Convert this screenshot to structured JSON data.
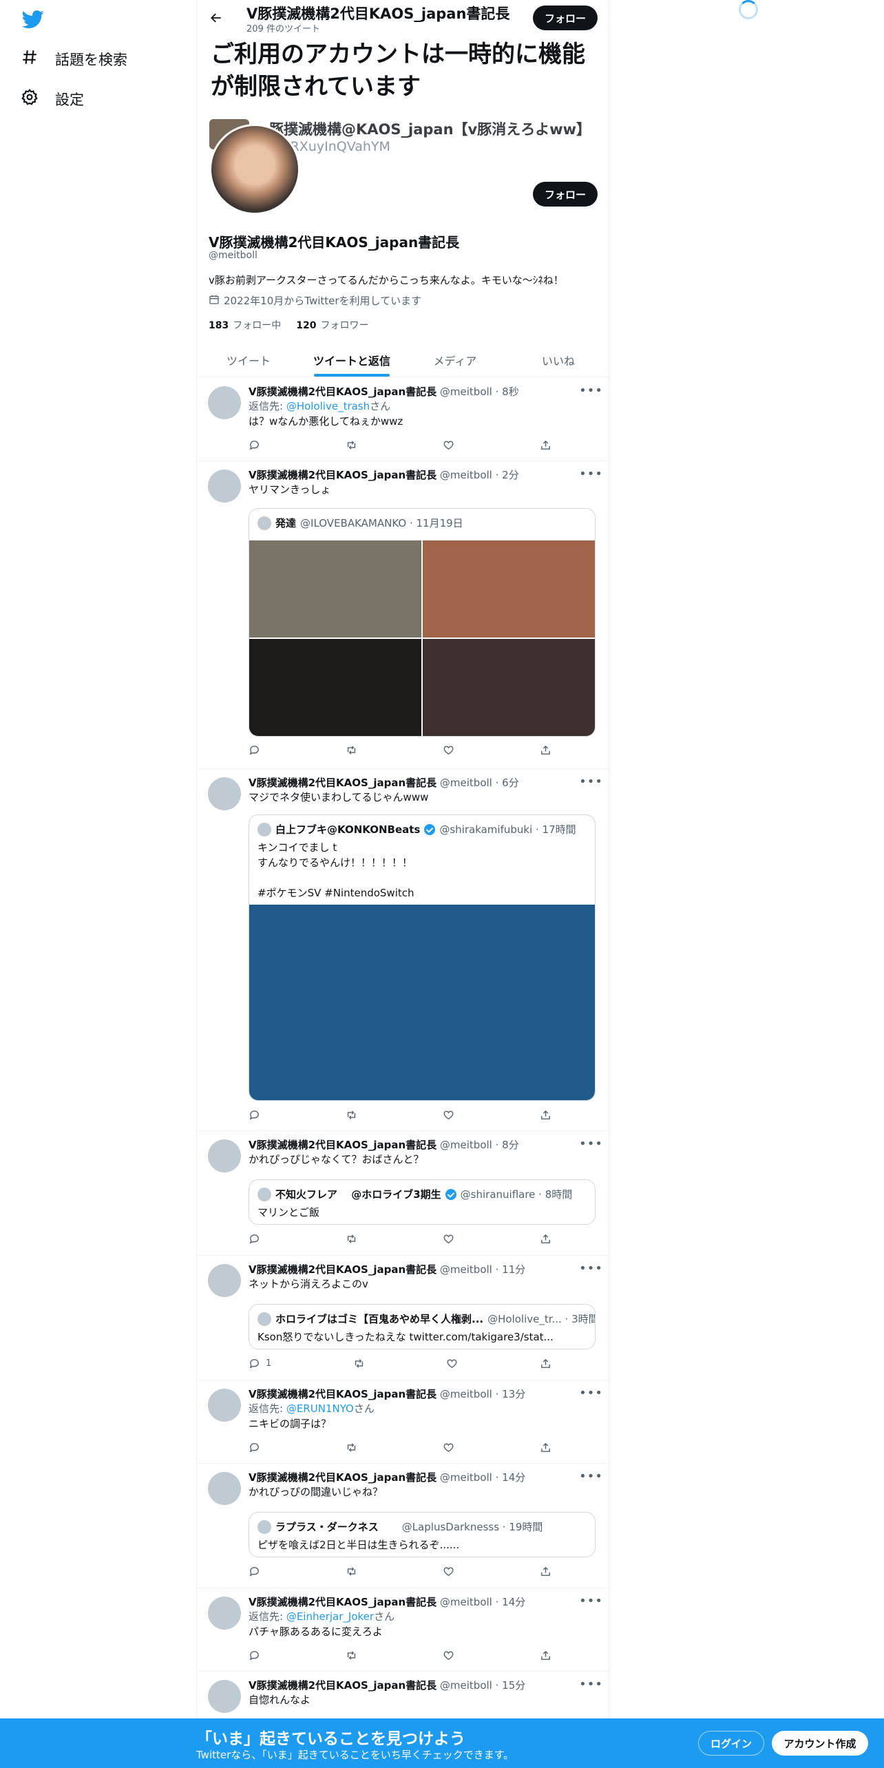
{
  "nav": {
    "explore_label": "話題を検索",
    "settings_label": "設定"
  },
  "header": {
    "title": "V豚撲滅機構2代目KAOS_japan書記長",
    "tweet_count": "209 件のツイート",
    "follow_label": "フォロー"
  },
  "restricted_notice": "ご利用のアカウントは一時的に機能が制限されています",
  "related_account": {
    "name": "豚撲滅機構@KAOS_japan【v豚消えろよww】",
    "handle": "IRXuyInQVahYM"
  },
  "profile": {
    "follow_label": "フォロー",
    "display_name": "V豚撲滅機構2代目KAOS_japan書記長",
    "handle": "@meitboll",
    "bio": "v豚お前剥アークスターさってるんだからこっち来んなよ。キモいな〜ｼﾈね！",
    "joined": "2022年10月からTwitterを利用しています",
    "following_count": "183",
    "following_label": "フォロー中",
    "followers_count": "120",
    "followers_label": "フォロワー"
  },
  "tabs": [
    "ツイート",
    "ツイートと返信",
    "メディア",
    "いいね"
  ],
  "tweets": [
    {
      "name": "V豚撲滅機構2代目KAOS_japan書記長",
      "meta": "@meitboll · 8秒",
      "reply_prefix": "返信先: ",
      "reply_to": "@Hololive_trash",
      "reply_suffix": "さん",
      "text": "は？wなんか悪化してねぇかwwz"
    },
    {
      "name": "V豚撲滅機構2代目KAOS_japan書記長",
      "meta": "@meitboll · 2分",
      "text": "ヤリマンきっしょ",
      "quote": {
        "name": "発達",
        "meta": "@ILOVEBAKAMANKO · 11月19日"
      },
      "image_colors": [
        "#7a7467",
        "#a0644b",
        "#1f1a1a",
        "#3e2f2e"
      ]
    },
    {
      "name": "V豚撲滅機構2代目KAOS_japan書記長",
      "meta": "@meitboll · 6分",
      "text": "マジでネタ使いまわしてるじゃんwww",
      "quote": {
        "name": "白上フブキ@KONKONBeats",
        "meta": "@shirakamifubuki · 17時間",
        "text": "キンコイでまし t\nすんなりでるやんけ！！！！！！\n\n#ポケモンSV #NintendoSwitch"
      },
      "image_color": "#1f5a8b"
    },
    {
      "name": "V豚撲滅機構2代目KAOS_japan書記長",
      "meta": "@meitboll · 8分",
      "text": "かれぴっぴじゃなくて？おばさんと？",
      "quote": {
        "name": "不知火フレア　 @ホロライブ3期生",
        "meta": "@shiranuiflare · 8時間",
        "text": "マリンとご飯"
      }
    },
    {
      "name": "V豚撲滅機構2代目KAOS_japan書記長",
      "meta": "@meitboll · 11分",
      "text": "ネットから消えろよこのv",
      "quote": {
        "name": "ホロライブはゴミ【百鬼あやめ早く人権剥...",
        "meta": "@Hololive_tr... · 3時間",
        "text": "Kson怒りでないしきったねえな twitter.com/takigare3/stat..."
      },
      "reply_count": "1"
    },
    {
      "name": "V豚撲滅機構2代目KAOS_japan書記長",
      "meta": "@meitboll · 13分",
      "reply_prefix": "返信先: ",
      "reply_to": "@ERUN1NYO",
      "reply_suffix": "さん",
      "text": "ニキビの調子は？"
    },
    {
      "name": "V豚撲滅機構2代目KAOS_japan書記長",
      "meta": "@meitboll · 14分",
      "text": "かれぴっぴの間違いじゃね？",
      "quote": {
        "name": "ラプラス・ダークネス",
        "meta": "@LaplusDarknesss · 19時間",
        "text": "ピザを喰えば2日と半日は生きられるぞ......"
      }
    },
    {
      "name": "V豚撲滅機構2代目KAOS_japan書記長",
      "meta": "@meitboll · 14分",
      "reply_prefix": "返信先: ",
      "reply_to": "@Einherjar_Joker",
      "reply_suffix": "さん",
      "text": "パチャ豚あるあるに変えろよ"
    },
    {
      "name": "V豚撲滅機構2代目KAOS_japan書記長",
      "meta": "@meitboll · 15分",
      "text": "自惚れんなよ"
    }
  ],
  "bottom_bar": {
    "title": "「いま」起きていることを見つけよう",
    "subtitle": "Twitterなら、「いま」起きていることをいち早くチェックできます。",
    "login_label": "ログイン",
    "signup_label": "アカウント作成"
  },
  "colors": {
    "accent": "#1d9bf0",
    "text_primary": "#0f1419",
    "text_secondary": "#536471"
  }
}
